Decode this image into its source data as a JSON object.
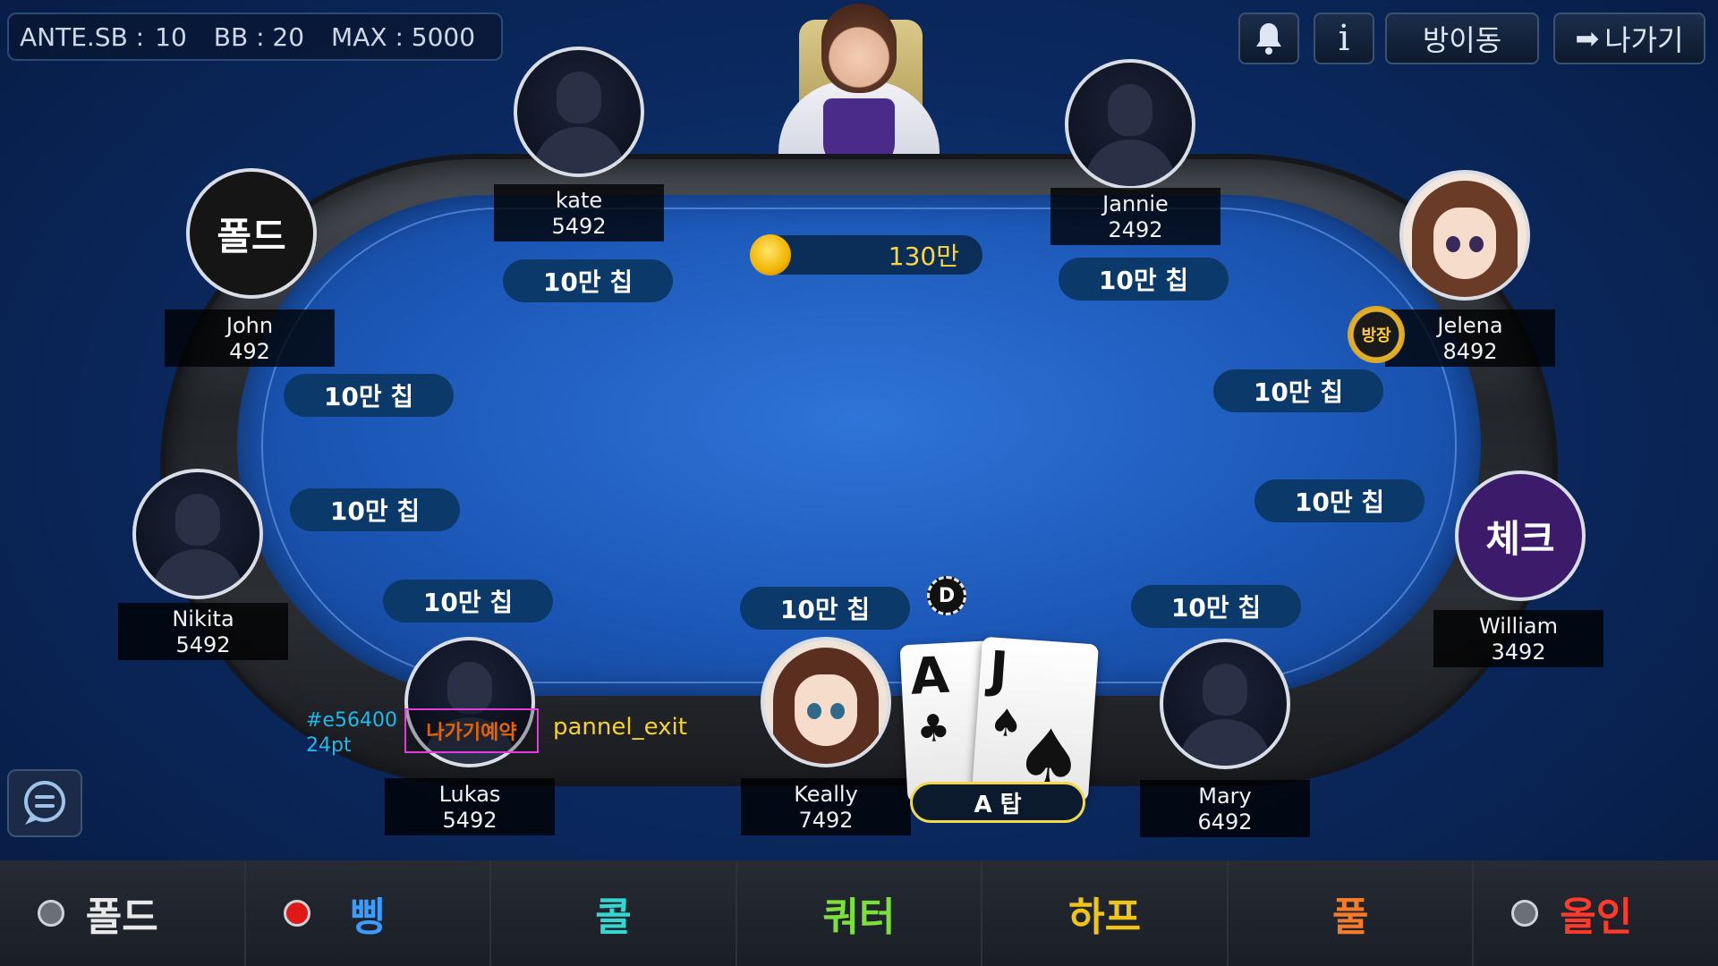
{
  "info_bar": {
    "ante_label": "ANTE.SB :",
    "ante_value": "10",
    "bb_label": "BB : 20",
    "max_label": "MAX : 5000"
  },
  "top_buttons": {
    "bell": "bell-icon",
    "info": "i",
    "move_room": "방이동",
    "exit": "나가기",
    "exit_arrow": "➡"
  },
  "pot": "130만",
  "players": {
    "kate": {
      "name": "kate",
      "chips": "5492",
      "bet": "10만 칩"
    },
    "jannie": {
      "name": "Jannie",
      "chips": "2492",
      "bet": "10만 칩"
    },
    "john": {
      "name": "John",
      "chips": "492",
      "status": "폴드",
      "bet": "10만 칩"
    },
    "jelena": {
      "name": "Jelena",
      "chips": "8492",
      "badge": "방장",
      "bet": "10만 칩"
    },
    "nikita": {
      "name": "Nikita",
      "chips": "5492",
      "bet": "10만 칩"
    },
    "william": {
      "name": "William",
      "chips": "3492",
      "status": "체크",
      "bet": "10만 칩"
    },
    "lukas": {
      "name": "Lukas",
      "chips": "5492",
      "bet": "10만 칩",
      "exit_reserve": "나가기예약"
    },
    "keally": {
      "name": "Keally",
      "chips": "7492",
      "bet": "10만 칩"
    },
    "mary": {
      "name": "Mary",
      "chips": "6492",
      "bet": "10만 칩"
    }
  },
  "dealer_button": "D",
  "hand": {
    "cards": [
      {
        "rank": "A",
        "suit": "♣"
      },
      {
        "rank": "J",
        "suit": "♠"
      }
    ],
    "label": "A 탑"
  },
  "annotation": {
    "color": "#e56400",
    "size": "24pt",
    "name": "pannel_exit"
  },
  "actions": [
    {
      "label": "폴드",
      "color": "#e8e8e8",
      "dot": "gray"
    },
    {
      "label": "삥",
      "color": "#3a9cff",
      "dot": "red"
    },
    {
      "label": "콜",
      "color": "#35d8d0"
    },
    {
      "label": "쿼터",
      "color": "#7de03a"
    },
    {
      "label": "하프",
      "color": "#f0c419"
    },
    {
      "label": "풀",
      "color": "#f57a2a"
    },
    {
      "label": "올인",
      "color": "#ff3a2a",
      "dot": "gray"
    }
  ]
}
